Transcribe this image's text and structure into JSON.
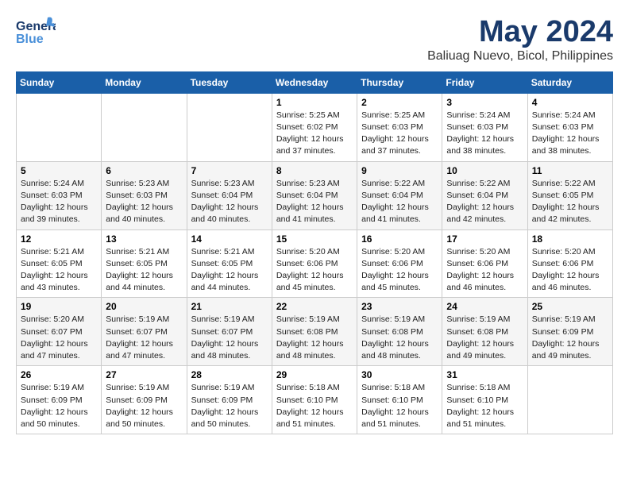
{
  "header": {
    "logo_general": "General",
    "logo_blue": "Blue",
    "main_title": "May 2024",
    "subtitle": "Baliuag Nuevo, Bicol, Philippines"
  },
  "calendar": {
    "days_of_week": [
      "Sunday",
      "Monday",
      "Tuesday",
      "Wednesday",
      "Thursday",
      "Friday",
      "Saturday"
    ],
    "weeks": [
      [
        {
          "day": "",
          "info": ""
        },
        {
          "day": "",
          "info": ""
        },
        {
          "day": "",
          "info": ""
        },
        {
          "day": "1",
          "info": "Sunrise: 5:25 AM\nSunset: 6:02 PM\nDaylight: 12 hours\nand 37 minutes."
        },
        {
          "day": "2",
          "info": "Sunrise: 5:25 AM\nSunset: 6:03 PM\nDaylight: 12 hours\nand 37 minutes."
        },
        {
          "day": "3",
          "info": "Sunrise: 5:24 AM\nSunset: 6:03 PM\nDaylight: 12 hours\nand 38 minutes."
        },
        {
          "day": "4",
          "info": "Sunrise: 5:24 AM\nSunset: 6:03 PM\nDaylight: 12 hours\nand 38 minutes."
        }
      ],
      [
        {
          "day": "5",
          "info": "Sunrise: 5:24 AM\nSunset: 6:03 PM\nDaylight: 12 hours\nand 39 minutes."
        },
        {
          "day": "6",
          "info": "Sunrise: 5:23 AM\nSunset: 6:03 PM\nDaylight: 12 hours\nand 40 minutes."
        },
        {
          "day": "7",
          "info": "Sunrise: 5:23 AM\nSunset: 6:04 PM\nDaylight: 12 hours\nand 40 minutes."
        },
        {
          "day": "8",
          "info": "Sunrise: 5:23 AM\nSunset: 6:04 PM\nDaylight: 12 hours\nand 41 minutes."
        },
        {
          "day": "9",
          "info": "Sunrise: 5:22 AM\nSunset: 6:04 PM\nDaylight: 12 hours\nand 41 minutes."
        },
        {
          "day": "10",
          "info": "Sunrise: 5:22 AM\nSunset: 6:04 PM\nDaylight: 12 hours\nand 42 minutes."
        },
        {
          "day": "11",
          "info": "Sunrise: 5:22 AM\nSunset: 6:05 PM\nDaylight: 12 hours\nand 42 minutes."
        }
      ],
      [
        {
          "day": "12",
          "info": "Sunrise: 5:21 AM\nSunset: 6:05 PM\nDaylight: 12 hours\nand 43 minutes."
        },
        {
          "day": "13",
          "info": "Sunrise: 5:21 AM\nSunset: 6:05 PM\nDaylight: 12 hours\nand 44 minutes."
        },
        {
          "day": "14",
          "info": "Sunrise: 5:21 AM\nSunset: 6:05 PM\nDaylight: 12 hours\nand 44 minutes."
        },
        {
          "day": "15",
          "info": "Sunrise: 5:20 AM\nSunset: 6:06 PM\nDaylight: 12 hours\nand 45 minutes."
        },
        {
          "day": "16",
          "info": "Sunrise: 5:20 AM\nSunset: 6:06 PM\nDaylight: 12 hours\nand 45 minutes."
        },
        {
          "day": "17",
          "info": "Sunrise: 5:20 AM\nSunset: 6:06 PM\nDaylight: 12 hours\nand 46 minutes."
        },
        {
          "day": "18",
          "info": "Sunrise: 5:20 AM\nSunset: 6:06 PM\nDaylight: 12 hours\nand 46 minutes."
        }
      ],
      [
        {
          "day": "19",
          "info": "Sunrise: 5:20 AM\nSunset: 6:07 PM\nDaylight: 12 hours\nand 47 minutes."
        },
        {
          "day": "20",
          "info": "Sunrise: 5:19 AM\nSunset: 6:07 PM\nDaylight: 12 hours\nand 47 minutes."
        },
        {
          "day": "21",
          "info": "Sunrise: 5:19 AM\nSunset: 6:07 PM\nDaylight: 12 hours\nand 48 minutes."
        },
        {
          "day": "22",
          "info": "Sunrise: 5:19 AM\nSunset: 6:08 PM\nDaylight: 12 hours\nand 48 minutes."
        },
        {
          "day": "23",
          "info": "Sunrise: 5:19 AM\nSunset: 6:08 PM\nDaylight: 12 hours\nand 48 minutes."
        },
        {
          "day": "24",
          "info": "Sunrise: 5:19 AM\nSunset: 6:08 PM\nDaylight: 12 hours\nand 49 minutes."
        },
        {
          "day": "25",
          "info": "Sunrise: 5:19 AM\nSunset: 6:09 PM\nDaylight: 12 hours\nand 49 minutes."
        }
      ],
      [
        {
          "day": "26",
          "info": "Sunrise: 5:19 AM\nSunset: 6:09 PM\nDaylight: 12 hours\nand 50 minutes."
        },
        {
          "day": "27",
          "info": "Sunrise: 5:19 AM\nSunset: 6:09 PM\nDaylight: 12 hours\nand 50 minutes."
        },
        {
          "day": "28",
          "info": "Sunrise: 5:19 AM\nSunset: 6:09 PM\nDaylight: 12 hours\nand 50 minutes."
        },
        {
          "day": "29",
          "info": "Sunrise: 5:18 AM\nSunset: 6:10 PM\nDaylight: 12 hours\nand 51 minutes."
        },
        {
          "day": "30",
          "info": "Sunrise: 5:18 AM\nSunset: 6:10 PM\nDaylight: 12 hours\nand 51 minutes."
        },
        {
          "day": "31",
          "info": "Sunrise: 5:18 AM\nSunset: 6:10 PM\nDaylight: 12 hours\nand 51 minutes."
        },
        {
          "day": "",
          "info": ""
        }
      ]
    ]
  }
}
